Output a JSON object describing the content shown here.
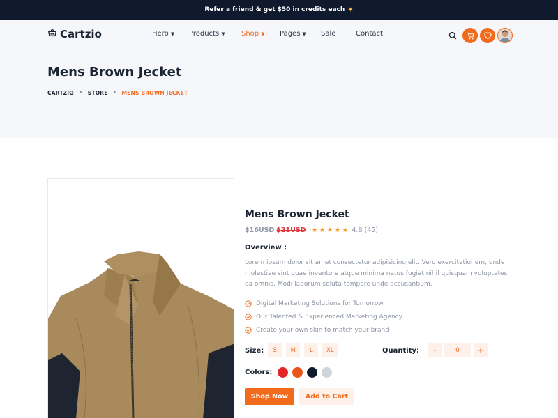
{
  "promo": {
    "text": "Refer a friend & get $50 in credits each",
    "icon": "sparkle-icon"
  },
  "brand": {
    "name": "Cartzio",
    "icon": "basket-icon"
  },
  "nav": [
    {
      "label": "Hero",
      "dropdown": true,
      "active": false
    },
    {
      "label": "Products",
      "dropdown": true,
      "active": false
    },
    {
      "label": "Shop",
      "dropdown": true,
      "active": true
    },
    {
      "label": "Pages",
      "dropdown": true,
      "active": false
    },
    {
      "label": "Sale",
      "dropdown": false,
      "active": false
    },
    {
      "label": "Contact",
      "dropdown": false,
      "active": false
    }
  ],
  "header_icons": [
    "search-icon",
    "cart-icon",
    "heart-icon",
    "avatar"
  ],
  "page": {
    "title": "Mens Brown Jecket",
    "breadcrumb": [
      "CARTZIO",
      "STORE",
      "MENS BROWN JECKET"
    ]
  },
  "product": {
    "title": "Mens Brown Jecket",
    "price": "$16USD",
    "old_price": "$21USD",
    "stars": "★★★★★",
    "rating": "4.8 (45)",
    "overview_label": "Overview :",
    "overview_text": "Lorem ipsum dolor sit amet consectetur adipisicing elit. Vero exercitationem, unde molestiae sint quae inventore atque minima natus fugiat nihil quisquam voluptates ea omnis. Modi laborum soluta tempore unde accusantium.",
    "features": [
      "Digital Marketing Solutions for Tomorrow",
      "Our Talented & Experienced Marketing Agency",
      "Create your own skin to match your brand"
    ],
    "size_label": "Size:",
    "sizes": [
      "S",
      "M",
      "L",
      "XL"
    ],
    "quantity_label": "Quantity:",
    "qty_minus": "-",
    "quantity": "0",
    "qty_plus": "+",
    "colors_label": "Colors:",
    "colors": [
      "#e0262b",
      "#e8561b",
      "#0f1a2e",
      "#cfd4db"
    ],
    "shop_now": "Shop Now",
    "add_to_cart": "Add to Cart"
  },
  "accent_color": "#f26b1d"
}
